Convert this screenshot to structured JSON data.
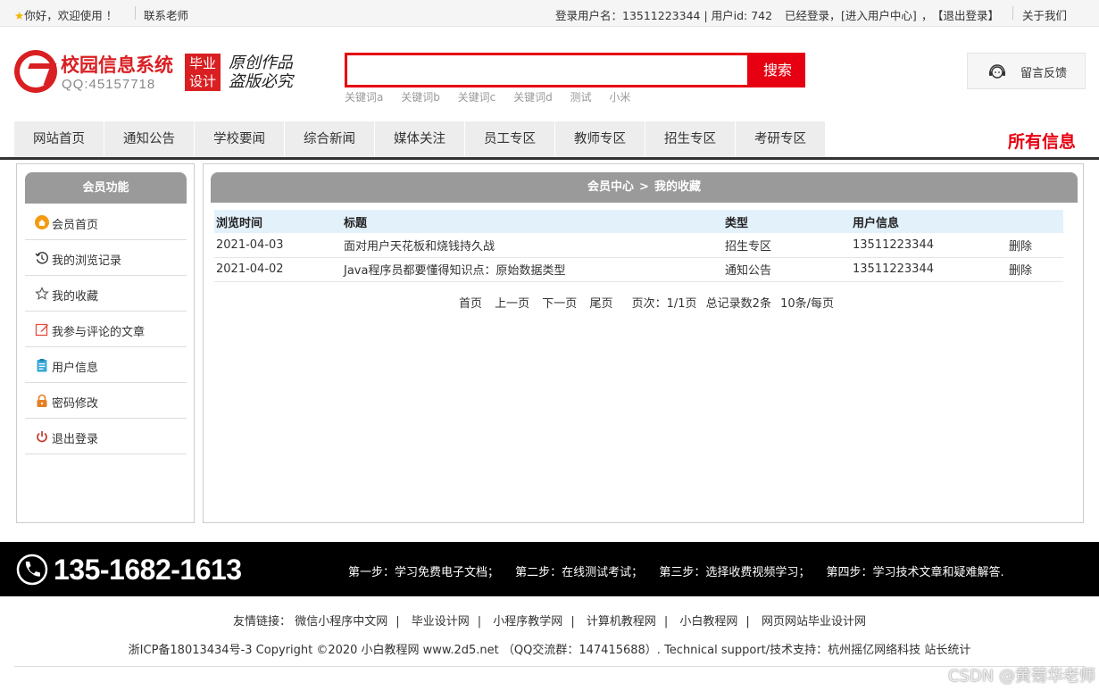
{
  "topbar": {
    "welcome": "你好，欢迎使用 ！",
    "contact": "联系老师",
    "login_info": "登录用户名：13511223344 | 用户id: 742",
    "logged_in": "已经登录，",
    "user_center": "[进入用户中心]",
    "comma": "，",
    "logout": "【退出登录】",
    "about": "关于我们"
  },
  "header": {
    "site_title": "校园信息系统",
    "qq": "QQ:45157718",
    "badge_line1": "毕业",
    "badge_line2": "设计",
    "slogan_line1": "原创作品",
    "slogan_line2": "盗版必究",
    "search_placeholder": "",
    "search_button": "搜索",
    "keywords": [
      "关键词a",
      "关键词b",
      "关键词c",
      "关键词d",
      "测试",
      "小米"
    ],
    "feedback": "留言反馈"
  },
  "nav": {
    "items": [
      "网站首页",
      "通知公告",
      "学校要闻",
      "综合新闻",
      "媒体关注",
      "员工专区",
      "教师专区",
      "招生专区",
      "考研专区"
    ],
    "all_info": "所有信息"
  },
  "sidebar": {
    "title": "会员功能",
    "items": [
      {
        "label": "会员首页",
        "icon": "home-icon"
      },
      {
        "label": "我的浏览记录",
        "icon": "history-icon"
      },
      {
        "label": "我的收藏",
        "icon": "star-icon"
      },
      {
        "label": "我参与评论的文章",
        "icon": "edit-icon"
      },
      {
        "label": "用户信息",
        "icon": "clipboard-icon"
      },
      {
        "label": "密码修改",
        "icon": "lock-icon"
      },
      {
        "label": "退出登录",
        "icon": "power-icon"
      }
    ]
  },
  "main": {
    "crumb_home": "会员中心",
    "crumb_sep": ">",
    "crumb_current": "我的收藏",
    "columns": [
      "浏览时间",
      "标题",
      "类型",
      "用户信息",
      ""
    ],
    "rows": [
      {
        "time": "2021-04-03",
        "title": "面对用户天花板和烧钱持久战",
        "type": "招生专区",
        "user": "13511223344",
        "action": "删除"
      },
      {
        "time": "2021-04-02",
        "title": "Java程序员都要懂得知识点：原始数据类型",
        "type": "通知公告",
        "user": "13511223344",
        "action": "删除"
      }
    ],
    "pager": {
      "first": "首页",
      "prev": "上一页",
      "next": "下一页",
      "last": "尾页",
      "page_info": "页次：1/1页",
      "total": "总记录数2条",
      "per_page": "10条/每页"
    }
  },
  "footer": {
    "phone": "135-1682-1613",
    "steps": [
      "第一步：学习免费电子文档；",
      "第二步：在线测试考试；",
      "第三步：选择收费视频学习；",
      "第四步：学习技术文章和疑难解答."
    ],
    "links_label": "友情链接：",
    "links": [
      "微信小程序中文网",
      "毕业设计网",
      "小程序教学网",
      "计算机教程网",
      "小白教程网",
      "网页网站毕业设计网"
    ],
    "copyright": "浙ICP备18013434号-3 Copyright ©2020 小白教程网 www.2d5.net （QQ交流群：147415688）. Technical support/技术支持：杭州摇亿网络科技 站长统计",
    "watermark": "CSDN @黄菊华老师"
  },
  "colors": {
    "accent": "#e60012",
    "panel_header": "#9a9a9a",
    "table_header": "#e3f1fb"
  }
}
